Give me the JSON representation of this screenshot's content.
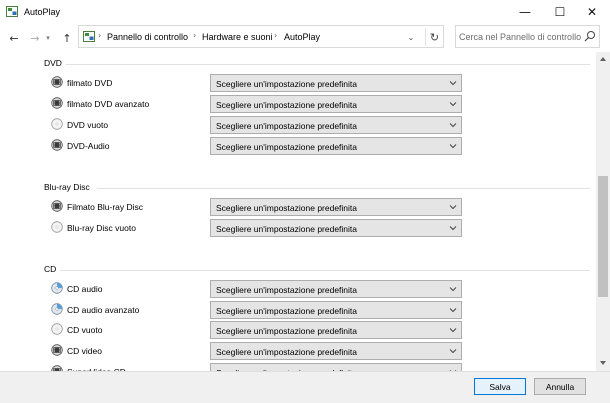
{
  "window": {
    "title": "AutoPlay",
    "minimize_glyph": "—",
    "maximize_glyph": "☐",
    "close_glyph": "✕"
  },
  "nav": {
    "back_glyph": "←",
    "forward_glyph": "→",
    "recent_glyph": "▾",
    "up_glyph": "↑",
    "breadcrumbs": [
      "Pannello di controllo",
      "Hardware e suoni",
      "AutoPlay"
    ],
    "separator_glyph": "›",
    "dropdown_glyph": "⌄",
    "refresh_glyph": "↻"
  },
  "search": {
    "placeholder": "Cerca nel Pannello di controllo"
  },
  "sections": [
    {
      "title": "DVD",
      "items": [
        {
          "label": "filmato DVD",
          "icon": "dvd-disc-icon",
          "value": "Scegliere un'impostazione predefinita"
        },
        {
          "label": "filmato DVD avanzato",
          "icon": "dvd-disc-icon",
          "value": "Scegliere un'impostazione predefinita"
        },
        {
          "label": "DVD vuoto",
          "icon": "blank-disc-icon",
          "value": "Scegliere un'impostazione predefinita"
        },
        {
          "label": "DVD-Audio",
          "icon": "dvd-disc-icon",
          "value": "Scegliere un'impostazione predefinita"
        }
      ]
    },
    {
      "title": "Blu-ray Disc",
      "items": [
        {
          "label": "Filmato Blu-ray Disc",
          "icon": "dvd-disc-icon",
          "value": "Scegliere un'impostazione predefinita"
        },
        {
          "label": "Blu-ray Disc vuoto",
          "icon": "blank-disc-icon",
          "value": "Scegliere un'impostazione predefinita"
        }
      ]
    },
    {
      "title": "CD",
      "items": [
        {
          "label": "CD audio",
          "icon": "audio-cd-icon",
          "value": "Scegliere un'impostazione predefinita"
        },
        {
          "label": "CD audio avanzato",
          "icon": "audio-cd-icon",
          "value": "Scegliere un'impostazione predefinita"
        },
        {
          "label": "CD vuoto",
          "icon": "blank-disc-icon",
          "value": "Scegliere un'impostazione predefinita"
        },
        {
          "label": "CD video",
          "icon": "dvd-disc-icon",
          "value": "Scegliere un'impostazione predefinita"
        },
        {
          "label": "SuperVideo CD",
          "icon": "dvd-disc-icon",
          "value": "Scegliere un'impostazione predefinita"
        }
      ]
    }
  ],
  "footer": {
    "save_label": "Salva",
    "cancel_label": "Annulla"
  },
  "colors": {
    "accent": "#0078d7",
    "select_bg": "#e5e5e5",
    "footer_bg": "#f0f0f0"
  }
}
